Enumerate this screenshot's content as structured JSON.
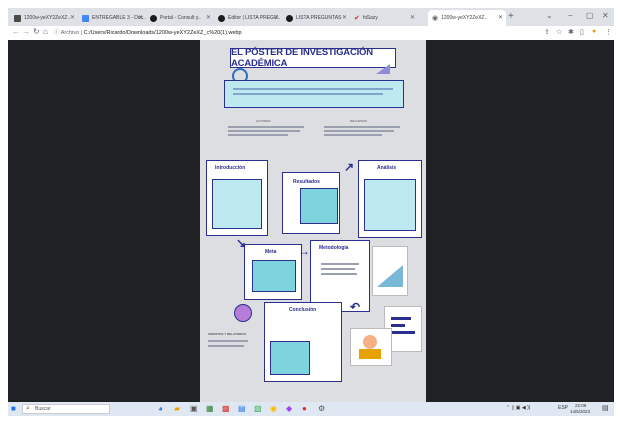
{
  "browser": {
    "tabs": [
      {
        "label": "1200w-yeXY2ZeXZ..",
        "icon_color": "#4a4a4a"
      },
      {
        "label": "ENTREGABLE 3 - Doc..",
        "icon_color": "#4285f4"
      },
      {
        "label": "Portal - Consult y..",
        "icon_color": "#1a1a1a"
      },
      {
        "label": "Editor | LISTA PREGU..",
        "icon_color": "#1a1a1a"
      },
      {
        "label": "LISTA PREGUNTAS",
        "icon_color": "#1a1a1a"
      },
      {
        "label": "hiSazy",
        "icon_color": "#d93025"
      },
      {
        "label": "1200w-yeXY2ZeXZ..",
        "icon_color": "#5f6368"
      }
    ],
    "url_label": "Archivo",
    "url_path": "C:/Users/Ricardo/Downloads/1200w-yeXY2ZeXZ_c%20(1).webp"
  },
  "poster": {
    "title": "EL PÓSTER DE INVESTIGACIÓN ACADÉMICA",
    "sections": {
      "intro": "Introducción",
      "results": "Resultados",
      "analysis": "Análisis",
      "goal": "Meta",
      "method": "Metodología",
      "conclusion": "Conclusión"
    },
    "labels": {
      "left_col": "AUTORES",
      "right_col": "RECURSOS",
      "bottom": "CREDITOS Y RELATORIAS"
    }
  },
  "taskbar": {
    "search_placeholder": "Buscar",
    "time": "22:09",
    "date": "14/5/2023",
    "lang": "ESP"
  }
}
